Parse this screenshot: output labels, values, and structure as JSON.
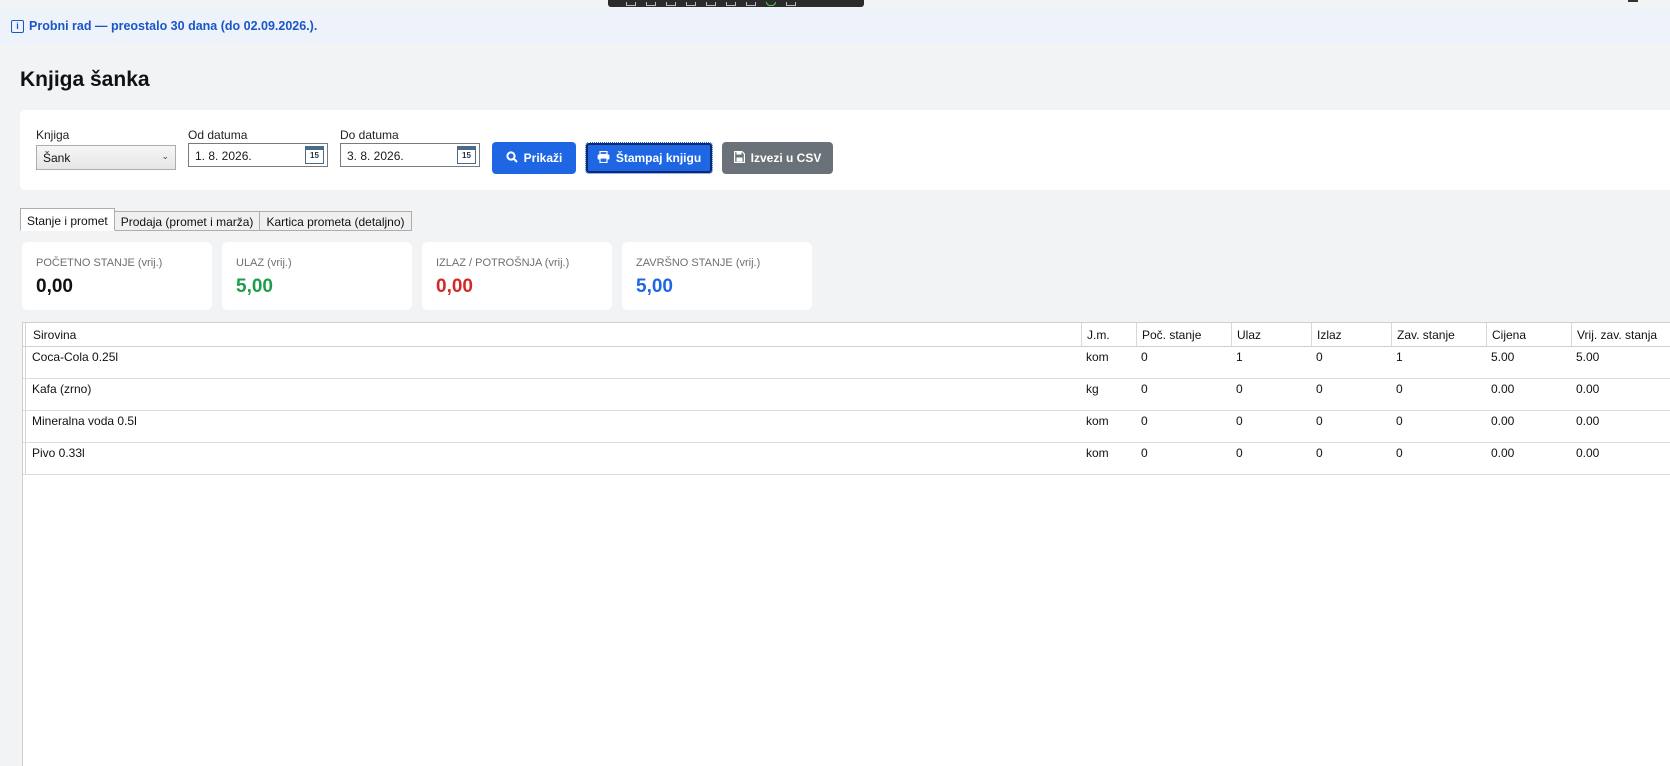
{
  "banner": {
    "icon": "info-icon",
    "text": "Probni rad — preostalo 30 dana (do 02.09.2026.)."
  },
  "page": {
    "title": "Knjiga šanka"
  },
  "filters": {
    "book_label": "Knjiga",
    "book_value": "Šank",
    "from_label": "Od datuma",
    "from_value": "1. 8. 2026.",
    "to_label": "Do datuma",
    "to_value": "3. 8. 2026.",
    "calendar_day": "15"
  },
  "buttons": {
    "show": "Prikaži",
    "print": "Štampaj knjigu",
    "export": "Izvezi u CSV"
  },
  "tabs": [
    {
      "label": "Stanje i promet",
      "active": true
    },
    {
      "label": "Prodaja (promet i marža)",
      "active": false
    },
    {
      "label": "Kartica prometa (detaljno)",
      "active": false
    }
  ],
  "stats": [
    {
      "label": "POČETNO STANJE (vrij.)",
      "value": "0,00",
      "color": "#111111"
    },
    {
      "label": "ULAZ (vrij.)",
      "value": "5,00",
      "color": "#1e9e4a"
    },
    {
      "label": "IZLAZ / POTROŠNJA (vrij.)",
      "value": "0,00",
      "color": "#d42828"
    },
    {
      "label": "ZAVRŠNO STANJE (vrij.)",
      "value": "5,00",
      "color": "#1f66e5"
    }
  ],
  "table": {
    "columns": [
      "Sirovina",
      "J.m.",
      "Poč. stanje",
      "Ulaz",
      "Izlaz",
      "Zav. stanje",
      "Cijena",
      "Vrij. zav. stanja"
    ],
    "rows": [
      [
        "Coca-Cola 0.25l",
        "kom",
        "0",
        "1",
        "0",
        "1",
        "5.00",
        "5.00"
      ],
      [
        "Kafa (zrno)",
        "kg",
        "0",
        "0",
        "0",
        "0",
        "0.00",
        "0.00"
      ],
      [
        "Mineralna voda 0.5l",
        "kom",
        "0",
        "0",
        "0",
        "0",
        "0.00",
        "0.00"
      ],
      [
        "Pivo 0.33l",
        "kom",
        "0",
        "0",
        "0",
        "0",
        "0.00",
        "0.00"
      ]
    ]
  }
}
